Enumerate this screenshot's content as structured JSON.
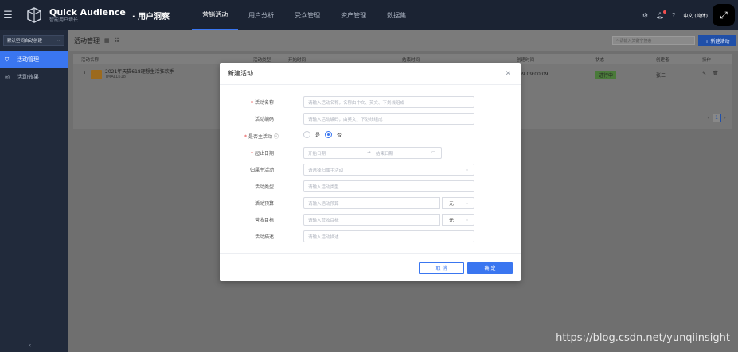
{
  "app": {
    "brand_title": "Quick Audience",
    "brand_sub": "智能用户增长",
    "product": "· 用户洞察"
  },
  "nav": {
    "items": [
      {
        "label": "营销活动"
      },
      {
        "label": "用户分析"
      },
      {
        "label": "受众管理"
      },
      {
        "label": "资产管理"
      },
      {
        "label": "数据集"
      }
    ]
  },
  "topright": {
    "lang": "中文 (简体)"
  },
  "sidebar": {
    "space": "默认空间自动创建",
    "items": [
      {
        "label": "活动管理"
      },
      {
        "label": "活动效果"
      }
    ]
  },
  "content": {
    "title": "活动管理",
    "search_placeholder": "请输入关键字搜索",
    "new_button": "+ 新建活动",
    "columns": [
      "活动名称",
      "活动类型",
      "开始时间",
      "结束时间",
      "创建时间",
      "状态",
      "创建者",
      "操作"
    ],
    "row": {
      "name": "2021年天猫618理想生活狂欢季",
      "code": "TMALL618",
      "created_time": "09 09:00:09",
      "status": "进行中",
      "creator": "张三"
    },
    "page": "1"
  },
  "modal": {
    "title": "新建活动",
    "fields": {
      "name_label": "活动名称：",
      "name_placeholder": "请输入活动名称，名称由中文、英文、下划线组成",
      "code_label": "活动编码：",
      "code_placeholder": "请输入活动编码，由英文、下划线组成",
      "is_main_label": "是否主活动",
      "yes": "是",
      "no": "否",
      "date_label": "起止日期：",
      "start_placeholder": "开始日期",
      "end_placeholder": "结束日期",
      "parent_label": "归属主活动：",
      "parent_placeholder": "请选择归属主活动",
      "type_label": "活动类型：",
      "type_placeholder": "请输入活动类型",
      "budget_label": "活动预算：",
      "budget_placeholder": "请输入活动预算",
      "budget_unit": "元",
      "target_label": "营收目标：",
      "target_placeholder": "请输入营收目标",
      "target_unit": "元",
      "desc_label": "活动描述：",
      "desc_placeholder": "请输入活动描述"
    },
    "cancel": "取 消",
    "ok": "确 定"
  },
  "watermark": "https://blog.csdn.net/yunqiinsight"
}
